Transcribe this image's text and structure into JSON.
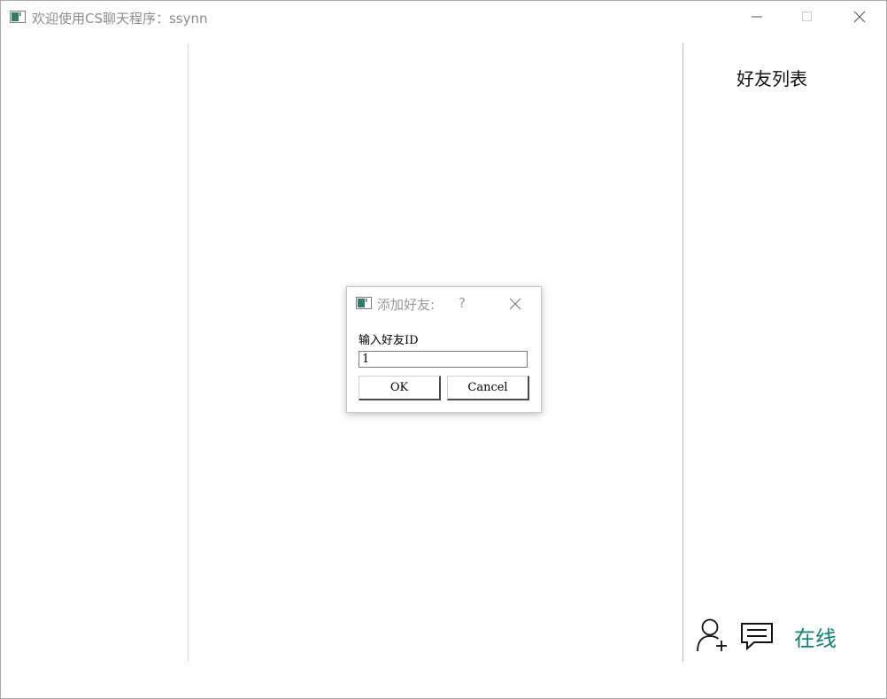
{
  "window": {
    "title": "欢迎使用CS聊天程序：ssynn",
    "icon": "app-window-icon"
  },
  "sidebar_right": {
    "title": "好友列表",
    "add_friend_icon": "add-user-icon",
    "message_icon": "chat-icon",
    "status": "在线",
    "status_color": "#0a8474"
  },
  "dialog": {
    "title": "添加好友:",
    "help": "?",
    "label": "输入好友ID",
    "input_value": "1",
    "ok_label": "OK",
    "cancel_label": "Cancel"
  }
}
